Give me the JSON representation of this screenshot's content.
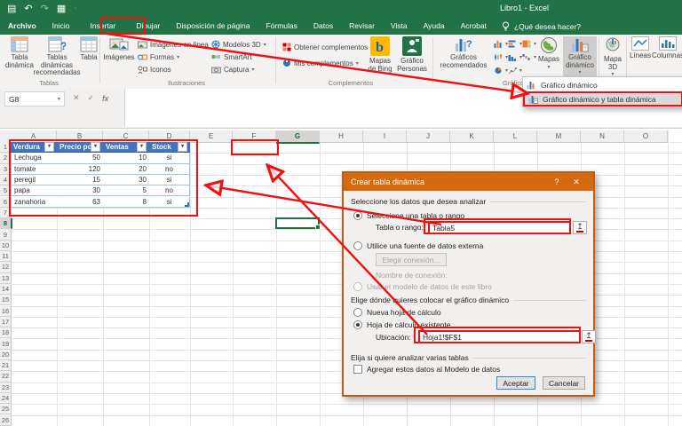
{
  "titlebar": {
    "title": "Libro1 - Excel"
  },
  "icons": {
    "save": "▤",
    "undo": "↶",
    "redo": "↷",
    "grid": "▦",
    "caret": "▾",
    "close": "✕",
    "check": "✓",
    "fx": "fx",
    "help": "?",
    "dialog_close": "✕",
    "refedit": "↥",
    "filter": "▾"
  },
  "tabs": {
    "items": [
      {
        "label": "Archivo"
      },
      {
        "label": "Inicio"
      },
      {
        "label": "Insertar"
      },
      {
        "label": "Dibujar"
      },
      {
        "label": "Disposición de página"
      },
      {
        "label": "Fórmulas"
      },
      {
        "label": "Datos"
      },
      {
        "label": "Revisar"
      },
      {
        "label": "Vista"
      },
      {
        "label": "Ayuda"
      },
      {
        "label": "Acrobat"
      }
    ],
    "active": "Insertar",
    "tellme": "¿Qué desea hacer?"
  },
  "ribbon": {
    "tablas": {
      "label": "Tablas",
      "pivot": "Tabla dinámica",
      "recommended": "Tablas dinámicas recomendadas",
      "table": "Tabla"
    },
    "ilustraciones": {
      "label": "Ilustraciones",
      "images": "Imágenes",
      "col1": [
        {
          "label": "Imágenes en línea"
        },
        {
          "label": "Formas",
          "caret": true
        },
        {
          "label": "Iconos"
        }
      ],
      "col2": [
        {
          "label": "Modelos 3D",
          "caret": true
        },
        {
          "label": "SmartArt"
        },
        {
          "label": "Captura",
          "caret": true
        }
      ]
    },
    "complementos": {
      "label": "Complementos",
      "get_addins": "Obtener complementos",
      "my_addins": "Mis complementos",
      "bing": "Mapas de Bing",
      "people": "Gráfico Personas"
    },
    "graficos": {
      "label": "Gráficos",
      "recommended": "Gráficos recomendados",
      "maps": "Mapas",
      "pivotchart": "Gráfico dinámico"
    },
    "map3d": {
      "label": "Mapa 3D"
    },
    "sparklines": {
      "lines": "Líneas",
      "columns": "Columnas"
    }
  },
  "menu": {
    "items": [
      {
        "label": "Gráfico dinámico"
      },
      {
        "label": "Gráfico dinámico y tabla dinámica"
      }
    ],
    "highlighted_index": 1
  },
  "formula_bar": {
    "name_box": "G8"
  },
  "grid": {
    "columns": [
      "A",
      "B",
      "C",
      "D",
      "E",
      "F",
      "G",
      "H",
      "I",
      "J",
      "K",
      "L",
      "M",
      "N",
      "O"
    ],
    "row_count": 26,
    "selected_column": "G",
    "selected_row": 8,
    "selected_cell": "G8"
  },
  "sheet_table": {
    "headers": [
      "Verdura",
      "Precio por",
      "Ventas",
      "Stock"
    ],
    "rows": [
      [
        "Lechuga",
        "50",
        "10",
        "si"
      ],
      [
        "tomate",
        "120",
        "20",
        "no"
      ],
      [
        "peregil",
        "15",
        "30",
        "si"
      ],
      [
        "papa",
        "30",
        "5",
        "no"
      ],
      [
        "zanahoria",
        "63",
        "8",
        "si"
      ]
    ]
  },
  "dialog": {
    "title": "Crear tabla dinámica",
    "section_source": "Seleccione los datos que desea analizar",
    "radio_select_table": "Seleccione una tabla o rango",
    "table_range_label": "Tabla o rango:",
    "table_range_value": "Tabla5",
    "radio_external": "Utilice una fuente de datos externa",
    "choose_connection": "Elegir conexión...",
    "connection_name": "Nombre de conexión:",
    "radio_data_model": "Usar el modelo de datos de este libro",
    "section_where": "Elige dónde quieres colocar el gráfico dinámico",
    "radio_new_sheet": "Nueva hoja de cálculo",
    "radio_existing_sheet": "Hoja de cálculo existente",
    "location_label": "Ubicación:",
    "location_value": "Hoja1!$F$1",
    "section_multiple": "Elija si quiere analizar varias tablas",
    "checkbox_model": "Agregar estos datos al Modelo de datos",
    "ok": "Aceptar",
    "cancel": "Cancelar"
  }
}
